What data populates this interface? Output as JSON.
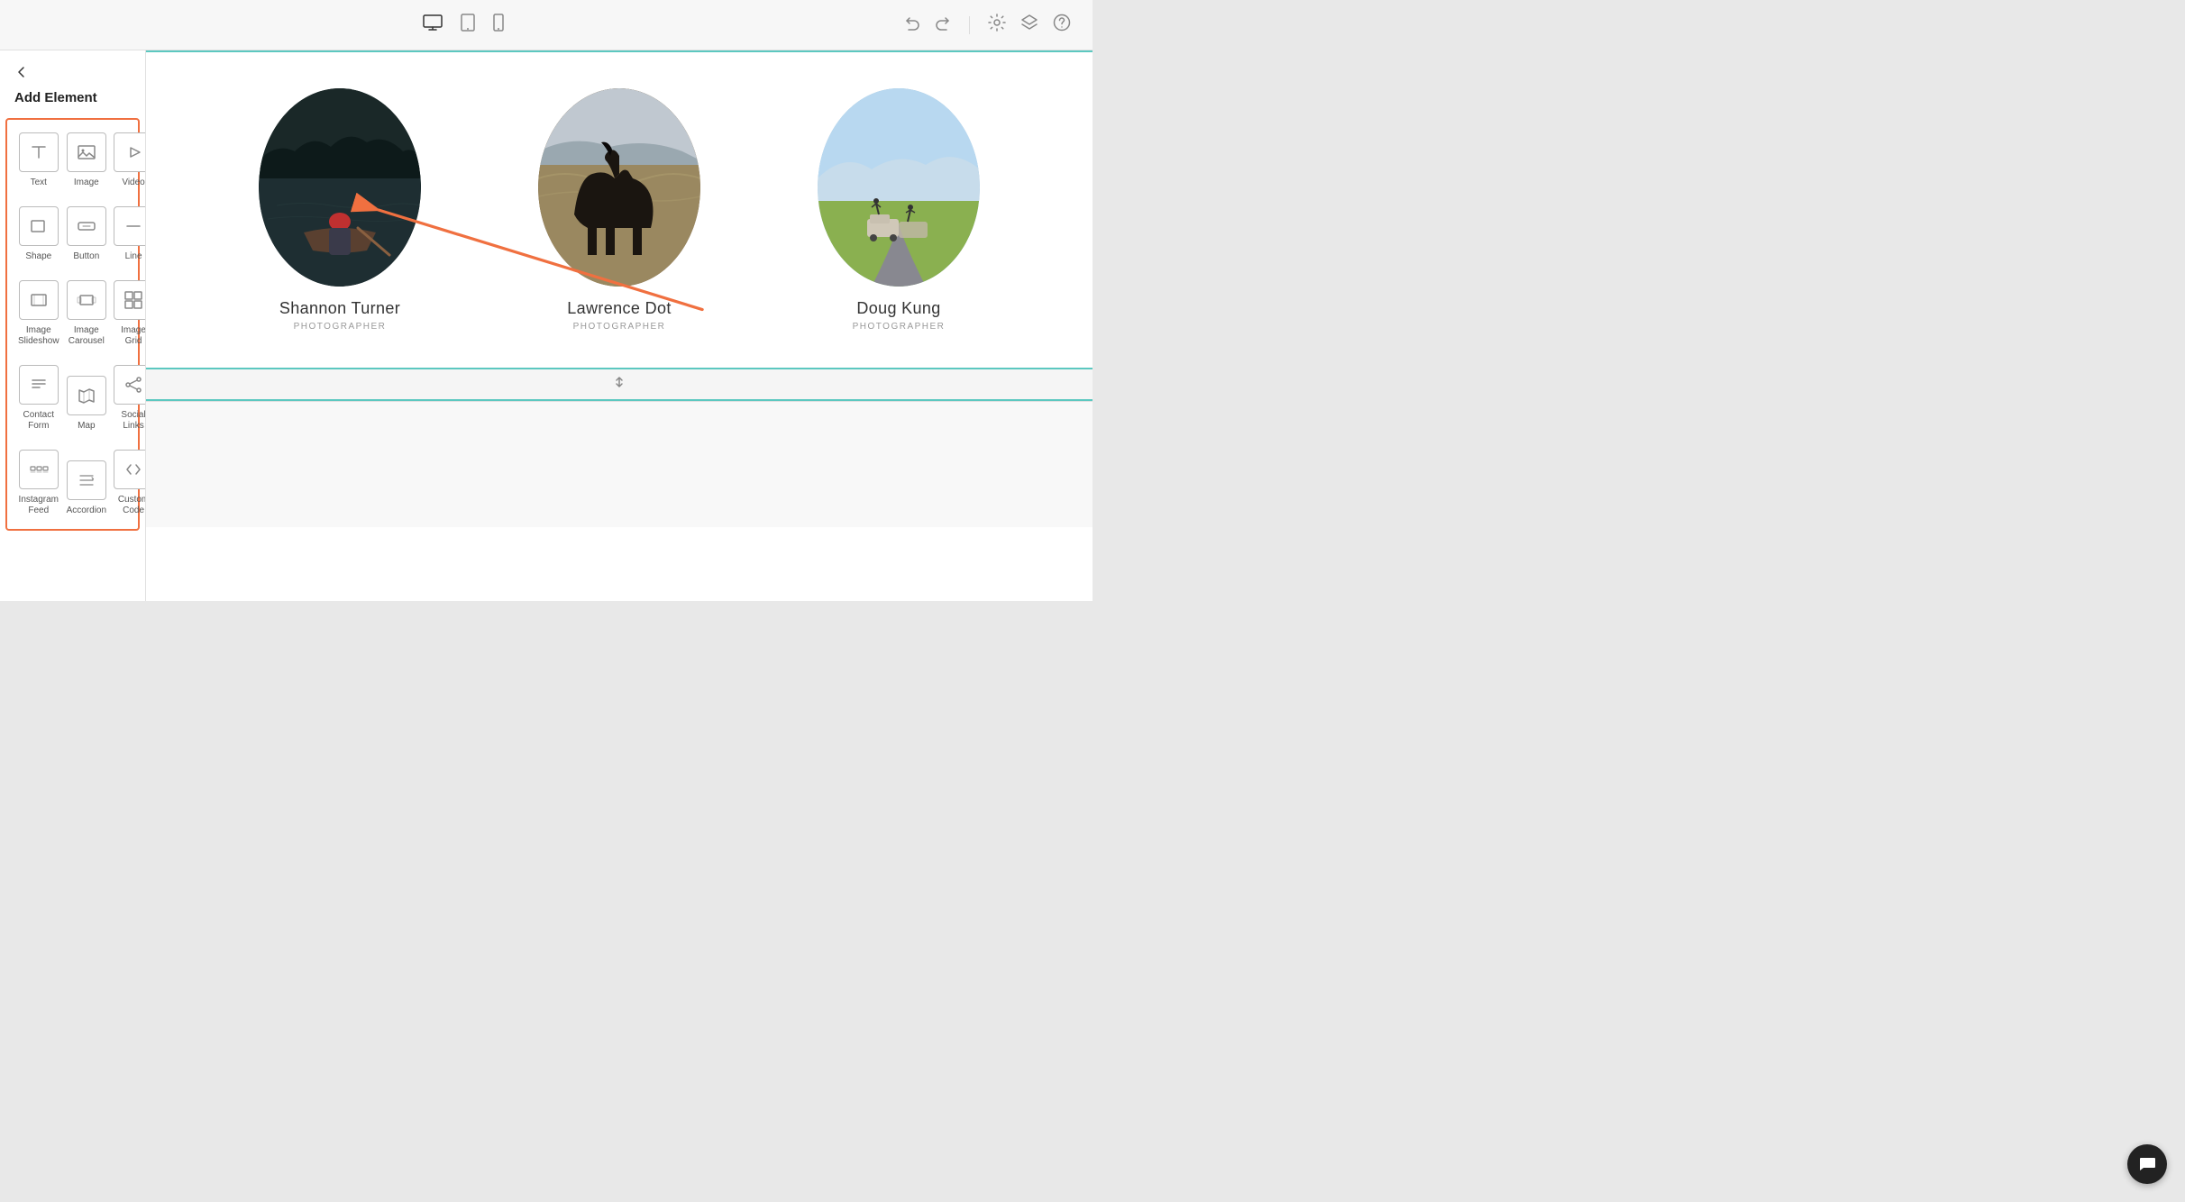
{
  "topbar": {
    "back_icon": "←",
    "device_icons": [
      "desktop",
      "tablet",
      "mobile"
    ],
    "undo_icon": "↩",
    "redo_icon": "↪",
    "settings_icon": "⚙",
    "layers_icon": "⊞",
    "help_icon": "?"
  },
  "sidebar": {
    "back_label": "←",
    "title": "Add Element",
    "elements": [
      {
        "id": "text",
        "label": "Text",
        "icon": "T"
      },
      {
        "id": "image",
        "label": "Image",
        "icon": "IMG"
      },
      {
        "id": "video",
        "label": "Video",
        "icon": "▷"
      },
      {
        "id": "shape",
        "label": "Shape",
        "icon": "□"
      },
      {
        "id": "button",
        "label": "Button",
        "icon": "BTN"
      },
      {
        "id": "line",
        "label": "Line",
        "icon": "—"
      },
      {
        "id": "image-slideshow",
        "label": "Image Slideshow",
        "icon": "⊡"
      },
      {
        "id": "image-carousel",
        "label": "Image Carousel",
        "icon": "⊟"
      },
      {
        "id": "image-grid",
        "label": "Image Grid",
        "icon": "⊞"
      },
      {
        "id": "contact-form",
        "label": "Contact Form",
        "icon": "≡"
      },
      {
        "id": "map",
        "label": "Map",
        "icon": "MAP"
      },
      {
        "id": "social-links",
        "label": "Social Links",
        "icon": "⇄"
      },
      {
        "id": "instagram-feed",
        "label": "Instagram Feed",
        "icon": "▦"
      },
      {
        "id": "accordion",
        "label": "Accordion",
        "icon": "≡+"
      },
      {
        "id": "custom-code",
        "label": "Custom Code",
        "icon": "</>"
      }
    ]
  },
  "canvas": {
    "section": {
      "people": [
        {
          "id": "shannon",
          "name": "Shannon Turner",
          "role": "PHOTOGRAPHER",
          "avatar_style": "dark-lake"
        },
        {
          "id": "lawrence",
          "name": "Lawrence Dot",
          "role": "PHOTOGRAPHER",
          "avatar_style": "dark-horse"
        },
        {
          "id": "doug",
          "name": "Doug Kung",
          "role": "PHOTOGRAPHER",
          "avatar_style": "light-road"
        }
      ]
    }
  }
}
